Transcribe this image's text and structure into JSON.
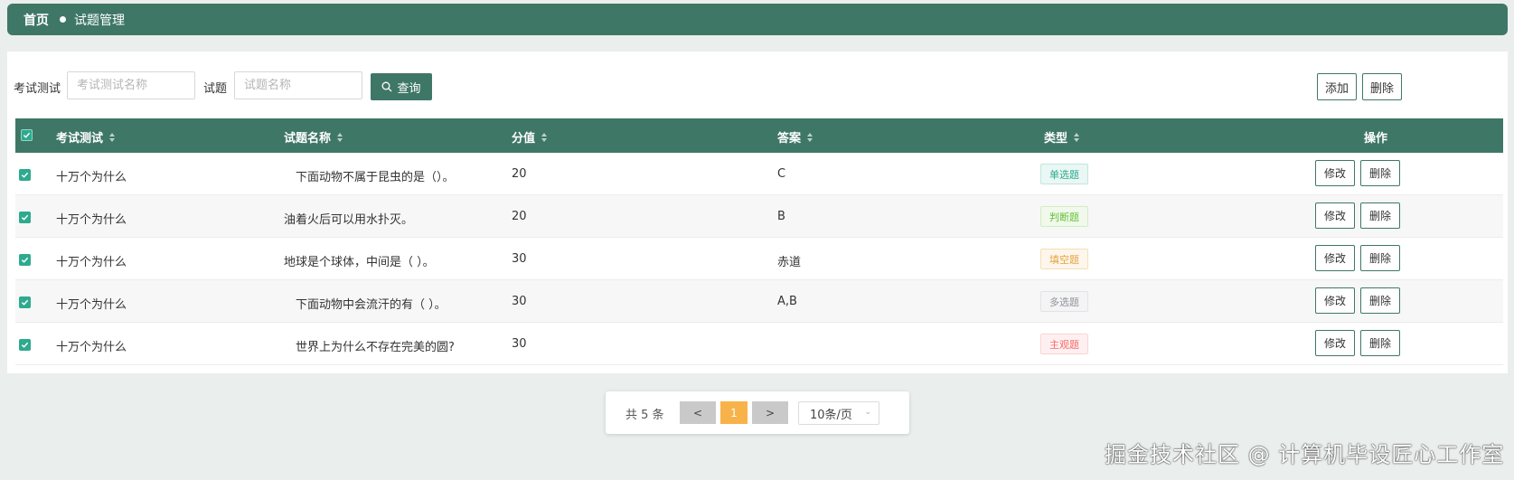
{
  "breadcrumb": {
    "home": "首页",
    "current": "试题管理"
  },
  "search": {
    "exam_label": "考试测试",
    "exam_placeholder": "考试测试名称",
    "question_label": "试题",
    "question_placeholder": "试题名称",
    "query_button": "查询",
    "add_button": "添加",
    "delete_button": "删除"
  },
  "table": {
    "columns": [
      "考试测试",
      "试题名称",
      "分值",
      "答案",
      "类型",
      "操作"
    ],
    "rows": [
      {
        "exam": "十万个为什么",
        "question": "下面动物不属于昆虫的是（）。",
        "score": "20",
        "answer": "C",
        "type": "单选题"
      },
      {
        "exam": "十万个为什么",
        "question": "油着火后可以用水扑灭。",
        "score": "20",
        "answer": "B",
        "type": "判断题"
      },
      {
        "exam": "十万个为什么",
        "question": "地球是个球体，中间是（ ）。",
        "score": "30",
        "answer": "赤道",
        "type": "填空题"
      },
      {
        "exam": "十万个为什么",
        "question": "下面动物中会流汗的有（ ）。",
        "score": "30",
        "answer": "A,B",
        "type": "多选题"
      },
      {
        "exam": "十万个为什么",
        "question": "世界上为什么不存在完美的圆?",
        "score": "30",
        "answer": "",
        "type": "主观题"
      }
    ],
    "edit_label": "修改",
    "delete_label": "删除"
  },
  "pagination": {
    "total": "共 5 条",
    "prev": "<",
    "current": "1",
    "next": ">",
    "page_size": "10条/页"
  },
  "watermark": "掘金技术社区 @ 计算机毕设匠心工作室",
  "colors": {
    "primary": "#3f7767",
    "checkbox": "#2eaa8e",
    "page_current": "#f7b34a",
    "tag_single": "#2eaa8e",
    "tag_judge": "#67c23a",
    "tag_fill": "#e6a23c",
    "tag_multi": "#909399",
    "tag_subjective": "#f56c6c"
  }
}
